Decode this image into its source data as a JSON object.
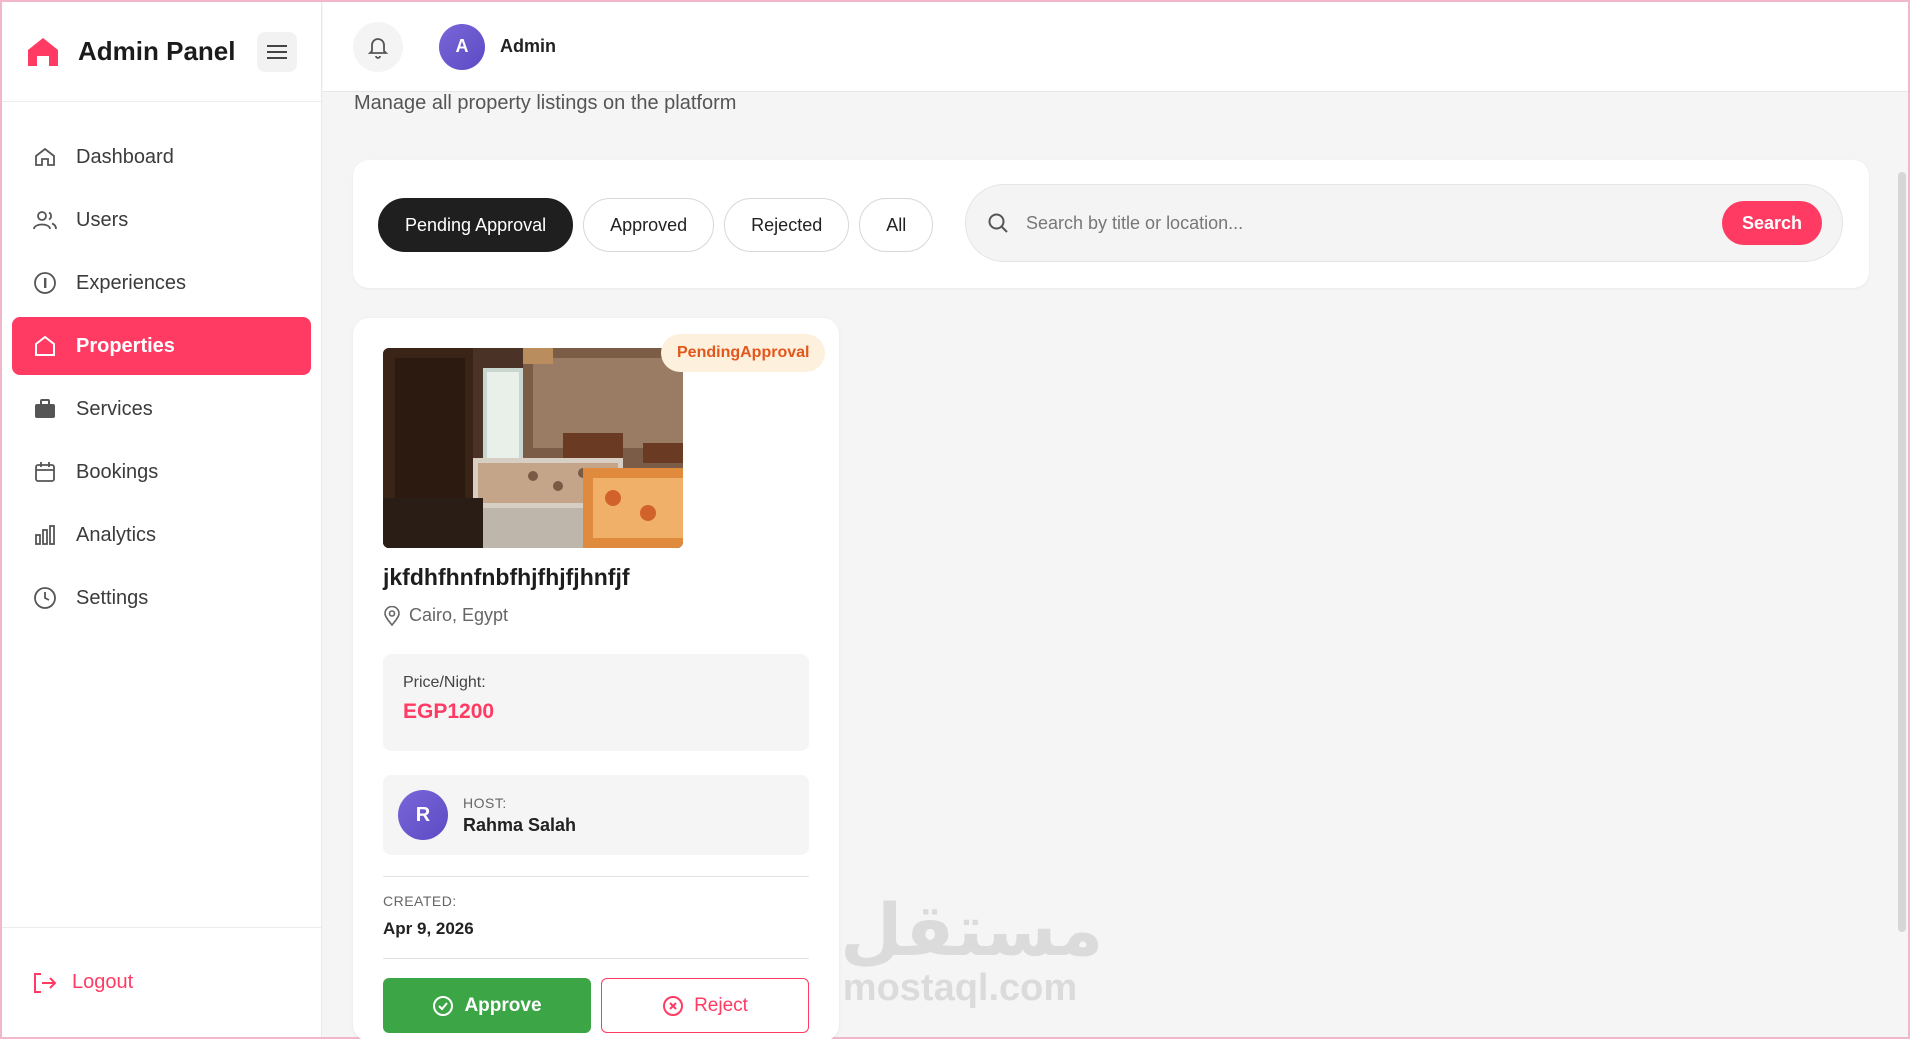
{
  "sidebar": {
    "brand": "Admin Panel",
    "items": [
      {
        "label": "Dashboard",
        "icon": "home-icon",
        "active": false
      },
      {
        "label": "Users",
        "icon": "users-icon",
        "active": false
      },
      {
        "label": "Experiences",
        "icon": "compass-icon",
        "active": false
      },
      {
        "label": "Properties",
        "icon": "house-icon",
        "active": true
      },
      {
        "label": "Services",
        "icon": "briefcase-icon",
        "active": false
      },
      {
        "label": "Bookings",
        "icon": "calendar-icon",
        "active": false
      },
      {
        "label": "Analytics",
        "icon": "bar-chart-icon",
        "active": false
      },
      {
        "label": "Settings",
        "icon": "clock-icon",
        "active": false
      }
    ],
    "logout_label": "Logout"
  },
  "header": {
    "avatar_initial": "A",
    "user_name": "Admin"
  },
  "page": {
    "subtitle": "Manage all property listings on the platform"
  },
  "filters": {
    "tabs": [
      "Pending Approval",
      "Approved",
      "Rejected",
      "All"
    ],
    "active_tab": "Pending Approval",
    "search_placeholder": "Search by title or location...",
    "search_value": "",
    "search_button": "Search"
  },
  "listing": {
    "status": "PendingApproval",
    "title": "jkfdhfhnfnbfhjfhjfjhnfjf",
    "location": "Cairo, Egypt",
    "price_label": "Price/Night:",
    "price": "EGP1200",
    "host_label": "HOST:",
    "host_initial": "R",
    "host_name": "Rahma Salah",
    "created_label": "CREATED:",
    "created_date": "Apr 9, 2026",
    "approve_label": "Approve",
    "reject_label": "Reject"
  },
  "watermark": {
    "arabic": "مستقل",
    "latin": "mostaql.com"
  },
  "colors": {
    "accent": "#ff3a63",
    "approve": "#3ca646",
    "badge_bg": "#fdf0dd",
    "badge_text": "#e2571c",
    "avatar": "#6b58cf"
  }
}
